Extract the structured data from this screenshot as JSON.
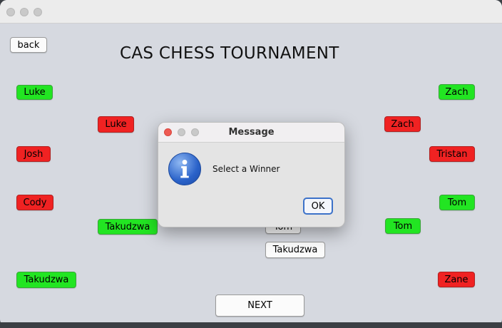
{
  "window": {
    "title": ""
  },
  "toolbar": {
    "back_label": "back",
    "next_label": "NEXT"
  },
  "page": {
    "heading": "CAS CHESS TOURNAMENT"
  },
  "bracket": {
    "left_round1": [
      "Luke",
      "Josh",
      "Cody",
      "Takudzwa"
    ],
    "left_round2": [
      "Luke",
      "Takudzwa"
    ],
    "right_round1": [
      "Zach",
      "Tristan",
      "Tom",
      "Zane"
    ],
    "right_round2": [
      "Zach",
      "Tom"
    ],
    "center": [
      "Tom",
      "Takudzwa"
    ]
  },
  "dialog": {
    "title": "Message",
    "message": "Select a Winner",
    "ok_label": "OK"
  },
  "colors": {
    "winner": "#22e522",
    "loser": "#f02222",
    "neutral": "#fbfbfb"
  }
}
